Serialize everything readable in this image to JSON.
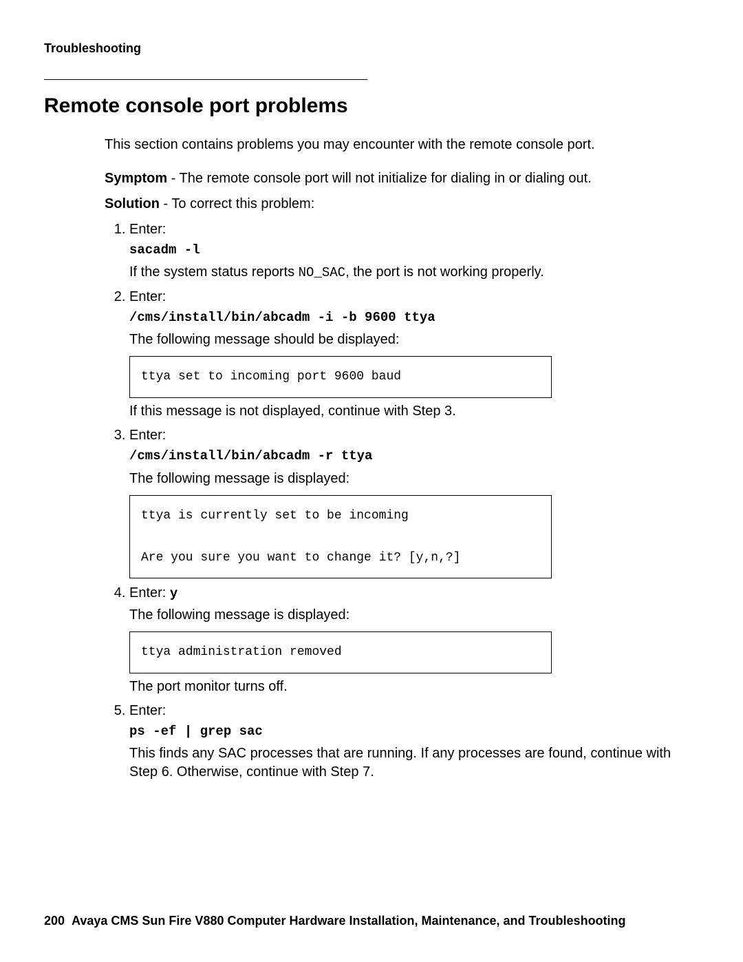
{
  "header": {
    "running_head": "Troubleshooting"
  },
  "section": {
    "title": "Remote console port problems",
    "intro": "This section contains problems you may encounter with the remote console port.",
    "symptom_label": "Symptom",
    "symptom_text": " - The remote console port will not initialize for dialing in or dialing out.",
    "solution_label": "Solution",
    "solution_text": " - To correct this problem:"
  },
  "steps": {
    "s1": {
      "enter_label": "Enter:",
      "cmd": "sacadm -l",
      "note_pre": "If the system status reports ",
      "note_code": "NO_SAC",
      "note_post": ", the port is not working properly."
    },
    "s2": {
      "enter_label": "Enter:",
      "cmd": "/cms/install/bin/abcadm -i -b 9600 ttya",
      "msg_intro": "The following message should be displayed:",
      "output": "ttya set to incoming port 9600 baud",
      "after": "If this message is not displayed, continue with Step 3."
    },
    "s3": {
      "enter_label": "Enter:",
      "cmd": "/cms/install/bin/abcadm -r ttya",
      "msg_intro": "The following message is displayed:",
      "output": "ttya is currently set to be incoming\n\nAre you sure you want to change it? [y,n,?]"
    },
    "s4": {
      "enter_label": "Enter: ",
      "cmd": "y",
      "msg_intro": "The following message is displayed:",
      "output": "ttya administration removed",
      "after": "The port monitor turns off."
    },
    "s5": {
      "enter_label": "Enter:",
      "cmd": "ps -ef | grep sac",
      "after": "This finds any SAC processes that are running. If any processes are found, continue with Step 6. Otherwise, continue with Step 7."
    }
  },
  "footer": {
    "page_number": "200",
    "book_title": "Avaya CMS Sun Fire V880 Computer Hardware Installation, Maintenance, and Troubleshooting"
  }
}
